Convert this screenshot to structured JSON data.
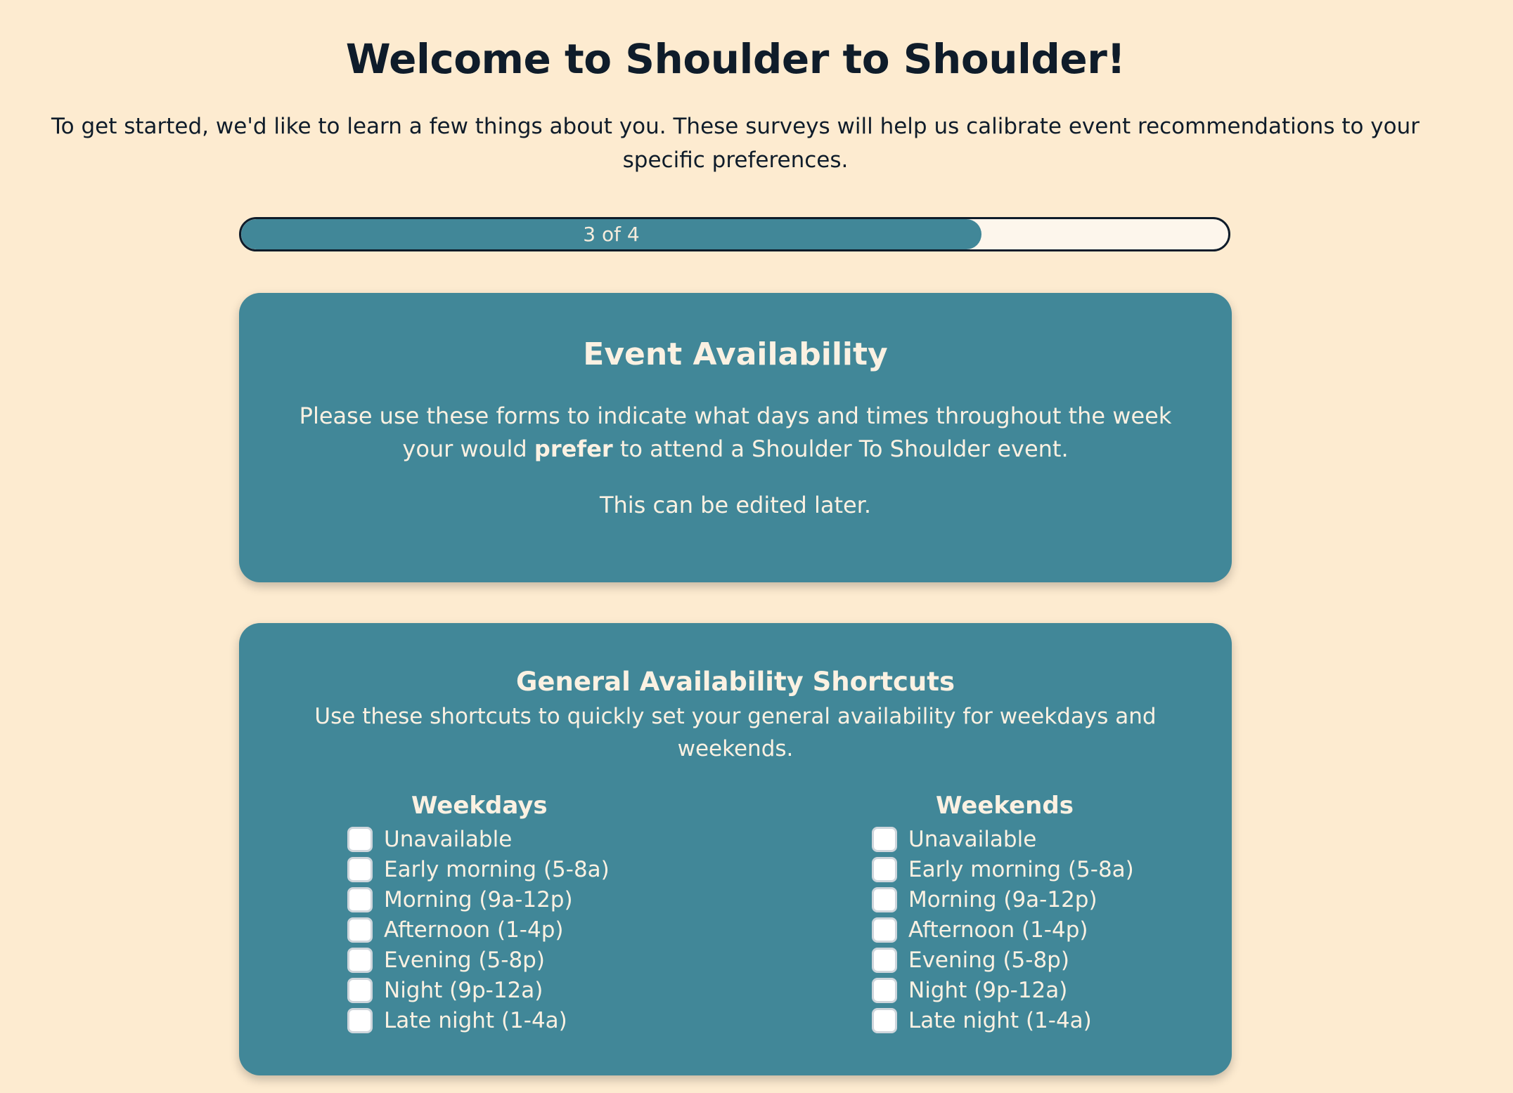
{
  "header": {
    "title": "Welcome to Shoulder to Shoulder!",
    "intro": "To get started, we'd like to learn a few things about you. These surveys will help us calibrate event recommendations to your specific preferences."
  },
  "progress": {
    "label": "3 of 4",
    "current_step": 3,
    "total_steps": 4
  },
  "availability_card": {
    "title": "Event Availability",
    "description_before": "Please use these forms to indicate what days and times throughout the week your would ",
    "description_bold": "prefer",
    "description_after": " to attend a Shoulder To Shoulder event.",
    "note": "This can be edited later."
  },
  "shortcuts_card": {
    "title": "General Availability Shortcuts",
    "description": "Use these shortcuts to quickly set your general availability for weekdays and weekends.",
    "columns": [
      {
        "heading": "Weekdays",
        "options": [
          "Unavailable",
          "Early morning (5-8a)",
          "Morning (9a-12p)",
          "Afternoon (1-4p)",
          "Evening (5-8p)",
          "Night (9p-12a)",
          "Late night (1-4a)"
        ]
      },
      {
        "heading": "Weekends",
        "options": [
          "Unavailable",
          "Early morning (5-8a)",
          "Morning (9a-12p)",
          "Afternoon (1-4p)",
          "Evening (5-8p)",
          "Night (9p-12a)",
          "Late night (1-4a)"
        ]
      }
    ]
  },
  "colors": {
    "background": "#fdebd0",
    "accent": "#418798",
    "text_dark": "#0f1c2a",
    "text_light": "#fbf1e2"
  }
}
